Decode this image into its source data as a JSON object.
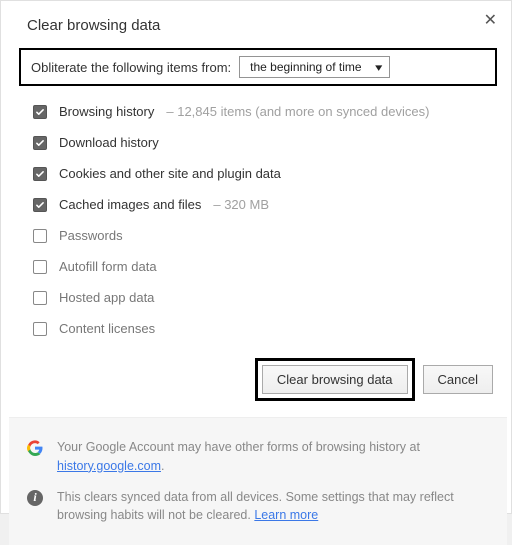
{
  "title": "Clear browsing data",
  "close_glyph": "✕",
  "obliterate": {
    "label": "Obliterate the following items from:",
    "selected": "the beginning of time"
  },
  "items": [
    {
      "checked": true,
      "label": "Browsing history",
      "detail": "–  12,845 items (and more on synced devices)"
    },
    {
      "checked": true,
      "label": "Download history",
      "detail": ""
    },
    {
      "checked": true,
      "label": "Cookies and other site and plugin data",
      "detail": ""
    },
    {
      "checked": true,
      "label": "Cached images and files",
      "detail": "–  320 MB"
    },
    {
      "checked": false,
      "label": "Passwords",
      "detail": ""
    },
    {
      "checked": false,
      "label": "Autofill form data",
      "detail": ""
    },
    {
      "checked": false,
      "label": "Hosted app data",
      "detail": ""
    },
    {
      "checked": false,
      "label": "Content licenses",
      "detail": ""
    }
  ],
  "actions": {
    "primary": "Clear browsing data",
    "cancel": "Cancel"
  },
  "footer": {
    "google_text_pre": "Your Google Account may have other forms of browsing history at ",
    "google_link": "history.google.com",
    "google_text_post": ".",
    "info_text_pre": "This clears synced data from all devices. Some settings that may reflect browsing habits will not be cleared. ",
    "info_link": "Learn more"
  }
}
